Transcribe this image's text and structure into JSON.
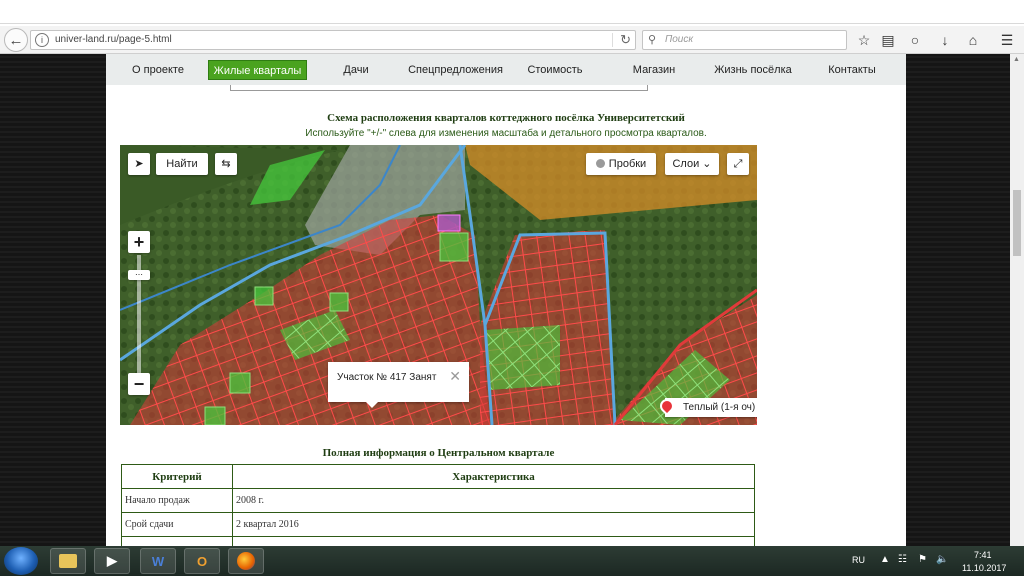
{
  "browser": {
    "url": "univer-land.ru/page-5.html",
    "search_placeholder": "Поиск",
    "back_icon": "arrow-left-icon",
    "reload_icon": "reload-icon"
  },
  "menu": {
    "items": [
      "О проекте",
      "Жилые кварталы",
      "Дачи",
      "Спецпредложения",
      "Стоимость",
      "Магазин",
      "Жизнь посёлка",
      "Контакты"
    ],
    "active_index": 1
  },
  "map_section": {
    "title": "Схема расположения кварталов коттеджного посёлка Университетский",
    "subtitle": "Используйте \"+/-\" слева для изменения масштаба и детального просмотра кварталов."
  },
  "map": {
    "find_button": "Найти",
    "traffic_button": "Пробки",
    "layers_button": "Слои",
    "zoom_in": "+",
    "zoom_out": "−",
    "popup_text": "Участок № 417  Занят",
    "pin_label": "Теплый (1-я оч)"
  },
  "info_section": {
    "title": "Полная информация о Центральном квартале",
    "headers": [
      "Критерий",
      "Характеристика"
    ],
    "rows": [
      [
        "Начало продаж",
        "2008 г."
      ],
      [
        "Срой сдачи",
        "2 квартал 2016"
      ],
      [
        "",
        ""
      ]
    ]
  },
  "taskbar": {
    "lang": "RU",
    "time": "7:41",
    "date": "11.10.2017"
  },
  "colors": {
    "menu_active": "#4aa31f",
    "plot_occupied": "#e03a3a",
    "plot_free": "#48c23a",
    "boundary": "#5aa7de",
    "heading": "#1f3d12"
  }
}
